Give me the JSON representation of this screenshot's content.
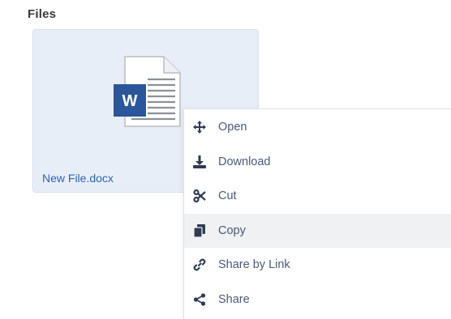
{
  "section": {
    "title": "Files"
  },
  "file": {
    "name": "New File.docx",
    "icon": "word-document-icon"
  },
  "context_menu": {
    "items": [
      {
        "label": "Open",
        "icon": "move-arrows-icon"
      },
      {
        "label": "Download",
        "icon": "download-icon"
      },
      {
        "label": "Cut",
        "icon": "scissors-icon"
      },
      {
        "label": "Copy",
        "icon": "copy-icon",
        "highlighted": true
      },
      {
        "label": "Share by Link",
        "icon": "link-icon"
      },
      {
        "label": "Share",
        "icon": "share-icon"
      }
    ]
  },
  "colors": {
    "card_background": "#e8eef8",
    "file_name": "#2c63b5",
    "word_blue": "#2b579a",
    "menu_hover": "#f0f1f3",
    "menu_text": "#4a5a7a"
  }
}
